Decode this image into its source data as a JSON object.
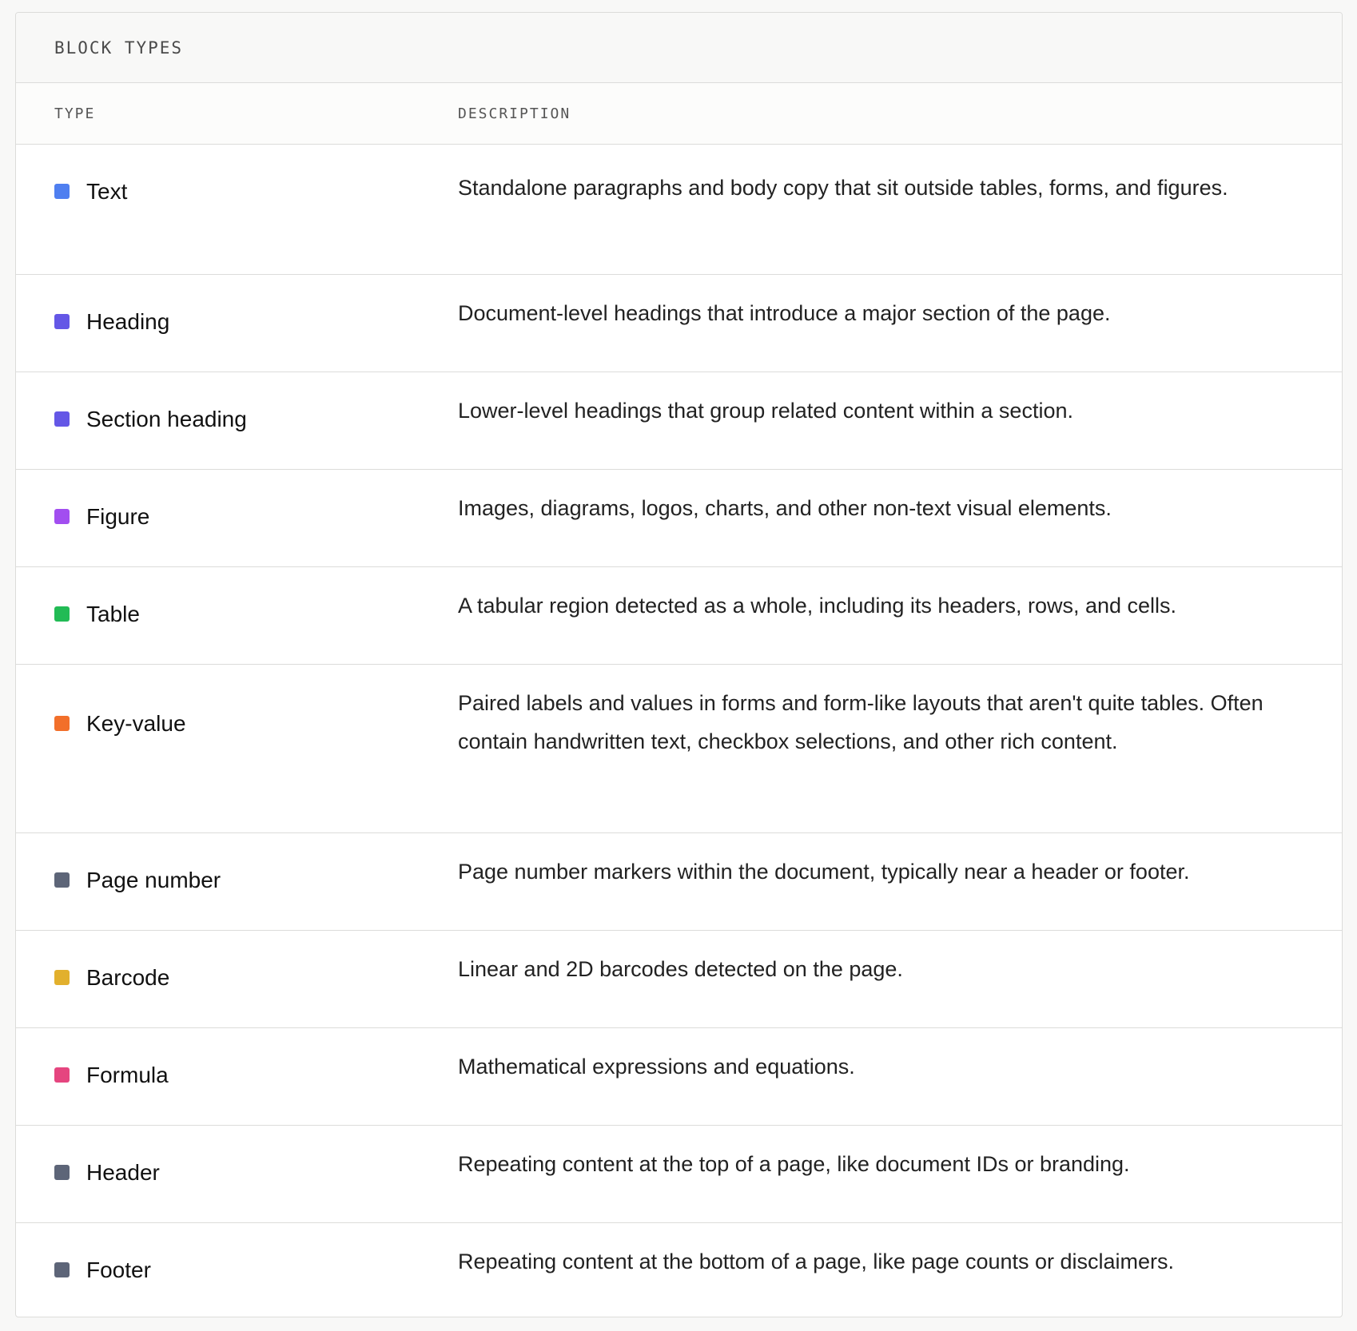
{
  "panel": {
    "title": "BLOCK TYPES",
    "columns": {
      "type": "TYPE",
      "description": "DESCRIPTION"
    }
  },
  "rows": [
    {
      "label": "Text",
      "color": "#4f7ff0",
      "description": "Standalone paragraphs and body copy that sit outside tables, forms, and figures."
    },
    {
      "label": "Heading",
      "color": "#6457e6",
      "description": "Document-level headings that introduce a major section of the page."
    },
    {
      "label": "Section heading",
      "color": "#6457e6",
      "description": "Lower-level headings that group related content within a section."
    },
    {
      "label": "Figure",
      "color": "#a24ef0",
      "description": "Images, diagrams, logos, charts, and other non-text visual elements."
    },
    {
      "label": "Table",
      "color": "#22bb55",
      "description": "A tabular region detected as a whole, including its headers, rows, and cells."
    },
    {
      "label": "Key-value",
      "color": "#f26f2a",
      "description": "Paired labels and values in forms and form-like layouts that aren't quite tables. Often contain handwritten text, checkbox selections, and other rich content."
    },
    {
      "label": "Page number",
      "color": "#5d6578",
      "description": "Page number markers within the document, typically near a header or footer."
    },
    {
      "label": "Barcode",
      "color": "#e2b02d",
      "description": "Linear and 2D barcodes detected on the page."
    },
    {
      "label": "Formula",
      "color": "#e5457f",
      "description": "Mathematical expressions and equations."
    },
    {
      "label": "Header",
      "color": "#5d6578",
      "description": "Repeating content at the top of a page, like document IDs or branding."
    },
    {
      "label": "Footer",
      "color": "#5d6578",
      "description": "Repeating content at the bottom of a page, like page counts or disclaimers."
    }
  ]
}
